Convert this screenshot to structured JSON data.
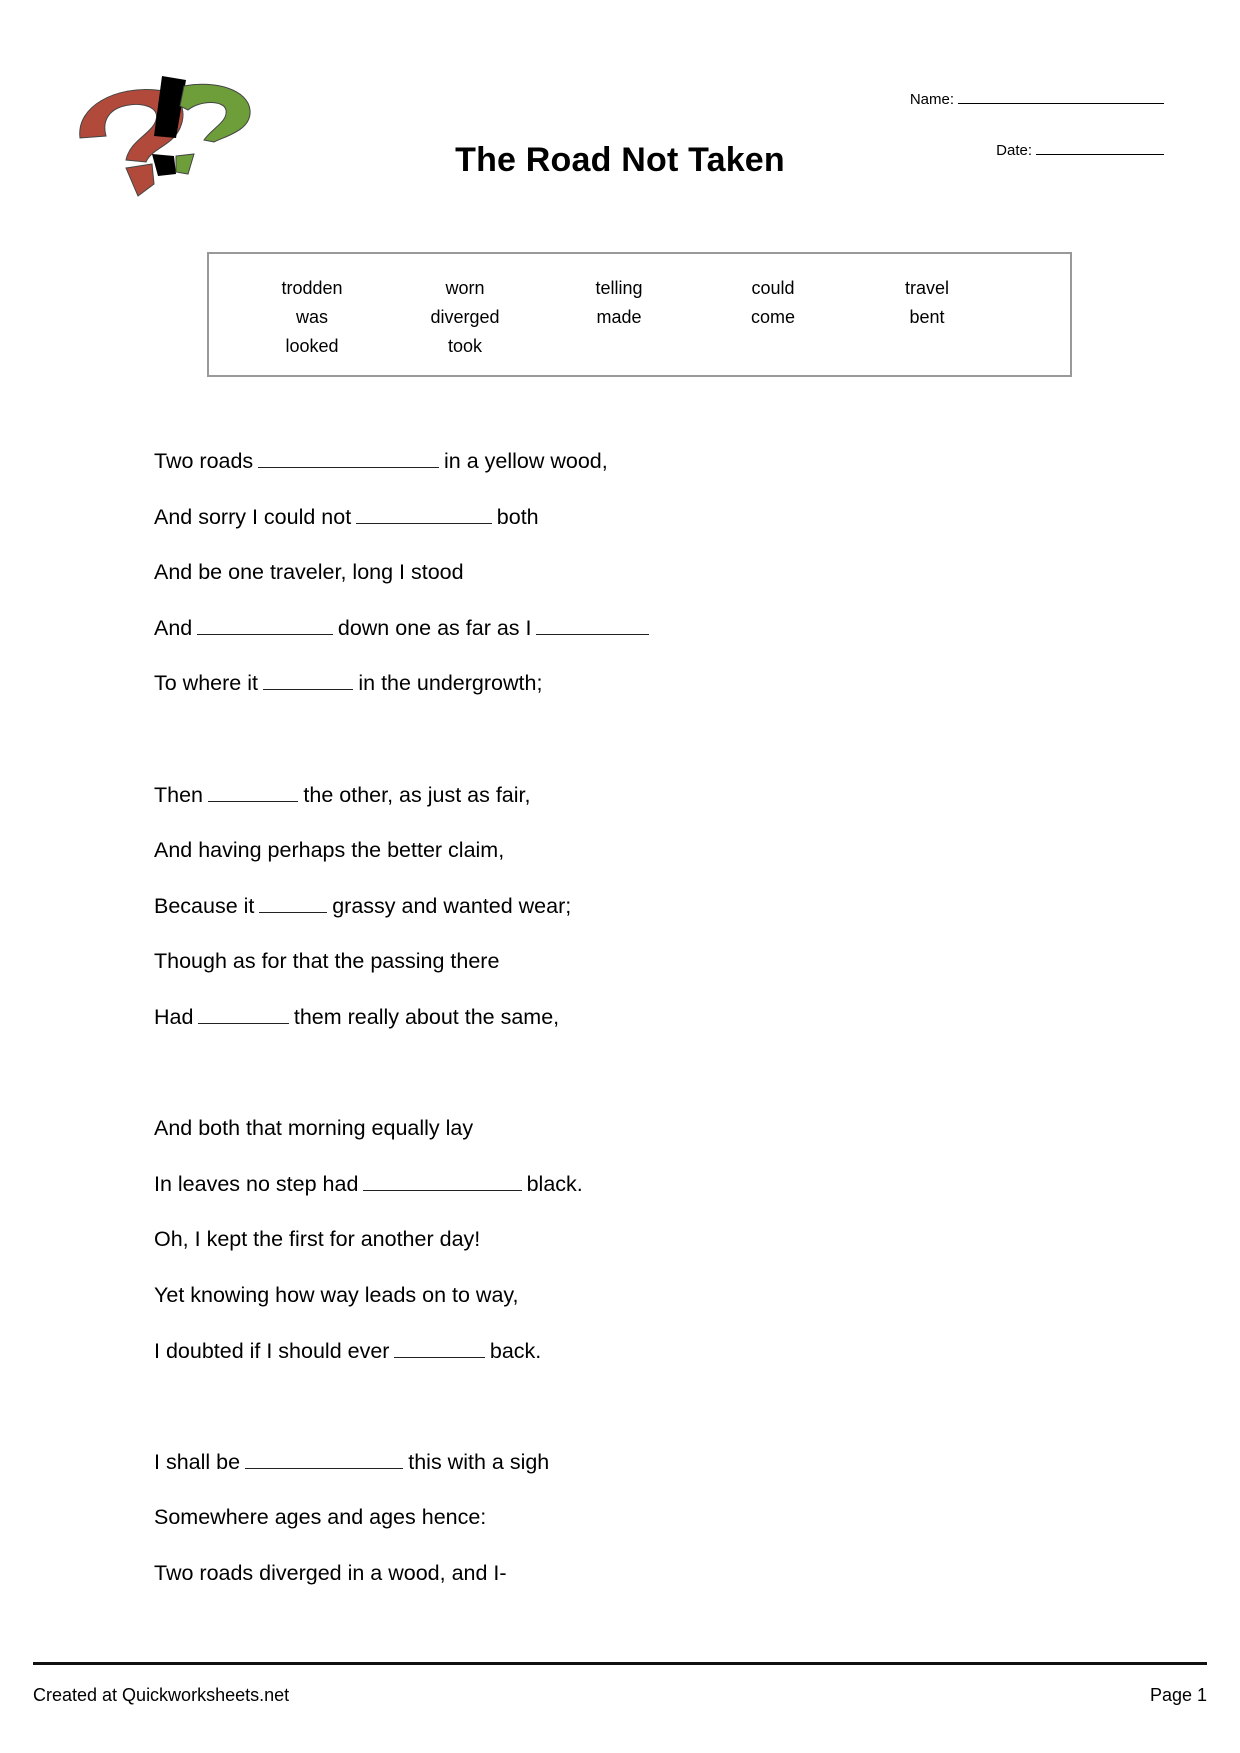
{
  "header": {
    "logo_icon": "question-exclamation-marks-logo",
    "title": "The Road Not Taken",
    "name_label": "Name:",
    "date_label": "Date:"
  },
  "word_bank": {
    "columns": [
      [
        "trodden",
        "was",
        "looked"
      ],
      [
        "worn",
        "diverged",
        "took"
      ],
      [
        "telling",
        "made"
      ],
      [
        "could",
        "come"
      ],
      [
        "travel",
        "bent"
      ]
    ]
  },
  "poem": {
    "stanzas": [
      [
        {
          "before": "Two roads",
          "blank": 16,
          "after": "in a yellow wood,"
        },
        {
          "before": "And sorry I could not",
          "blank": 12,
          "after": "both"
        },
        {
          "before": "And be one traveler, long I stood"
        },
        {
          "before": "And",
          "blank": 12,
          "after": "down one as far as I",
          "blank2": 10
        },
        {
          "before": "To where it",
          "blank": 8,
          "after": "in the undergrowth;"
        }
      ],
      [
        {
          "before": "Then",
          "blank": 8,
          "after": "the other, as just as fair,"
        },
        {
          "before": "And having perhaps the better claim,"
        },
        {
          "before": "Because it",
          "blank": 6,
          "after": "grassy and wanted wear;"
        },
        {
          "before": "Though as for that the passing there"
        },
        {
          "before": "Had",
          "blank": 8,
          "after": "them really about the same,"
        }
      ],
      [
        {
          "before": "And both that morning equally lay"
        },
        {
          "before": "In leaves no step had",
          "blank": 14,
          "after": "black."
        },
        {
          "before": "Oh, I kept the first for another day!"
        },
        {
          "before": "Yet knowing how way leads on to way,"
        },
        {
          "before": "I doubted if I should ever",
          "blank": 8,
          "after": "back."
        }
      ],
      [
        {
          "before": "I shall be",
          "blank": 14,
          "after": "this with a sigh"
        },
        {
          "before": "Somewhere ages and ages hence:"
        },
        {
          "before": "Two roads diverged in a wood, and I-"
        }
      ]
    ]
  },
  "footer": {
    "credit": "Created at Quickworksheets.net",
    "page": "Page 1"
  },
  "colors": {
    "logo_red": "#b24a3c",
    "logo_green": "#6e9e3a",
    "logo_black": "#000000",
    "box_border": "#999999"
  }
}
